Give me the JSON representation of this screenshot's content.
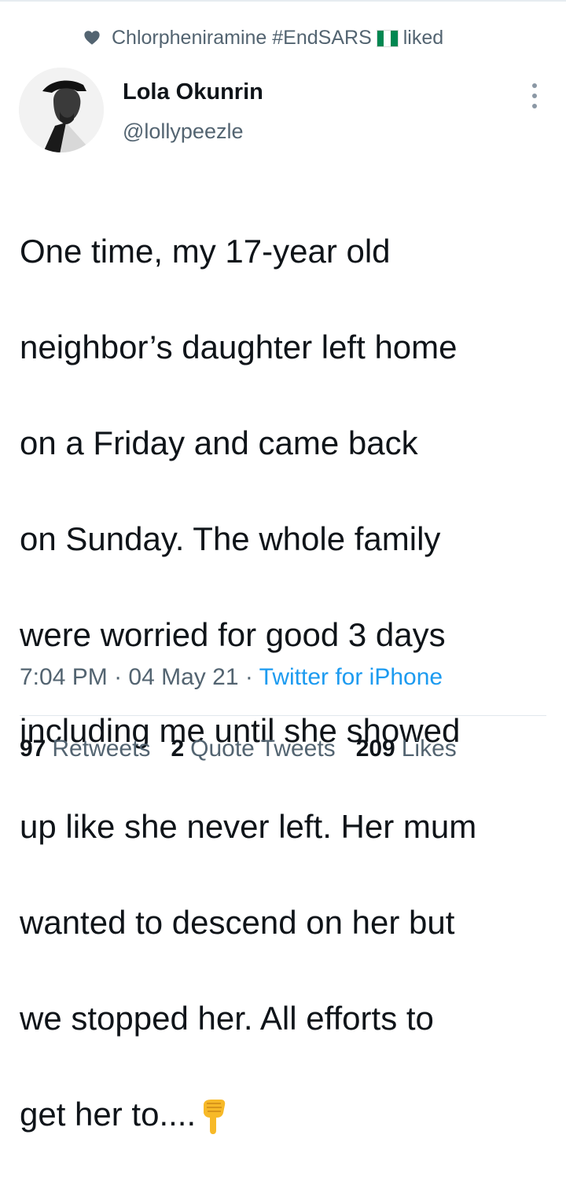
{
  "social_context": {
    "liker_name": "Chlorpheniramine #EndSARS",
    "action": "liked",
    "flag_colors": [
      "#008751",
      "#ffffff",
      "#008751"
    ]
  },
  "user": {
    "name": "Lola Okunrin",
    "handle": "@lollypeezle"
  },
  "tweet": {
    "lines": [
      "One time, my 17-year old",
      "neighbor’s daughter left home",
      "on a Friday and came back",
      "on Sunday. The whole family",
      "were worried for good 3 days",
      "including me until she showed",
      "up like she never left. Her mum",
      "wanted to descend on her but",
      "we stopped her. All efforts to",
      "get her to...."
    ],
    "emoji": "👇"
  },
  "meta": {
    "time": "7:04 PM",
    "separator": "·",
    "date": "04 May 21",
    "source": "Twitter for iPhone"
  },
  "stats": {
    "retweets_count": "97",
    "retweets_label": "Retweets",
    "quotes_count": "2",
    "quotes_label": "Quote Tweets",
    "likes_count": "209",
    "likes_label": "Likes"
  },
  "colors": {
    "text": "#0f1419",
    "secondary": "#536471",
    "link": "#1d9bf0"
  }
}
